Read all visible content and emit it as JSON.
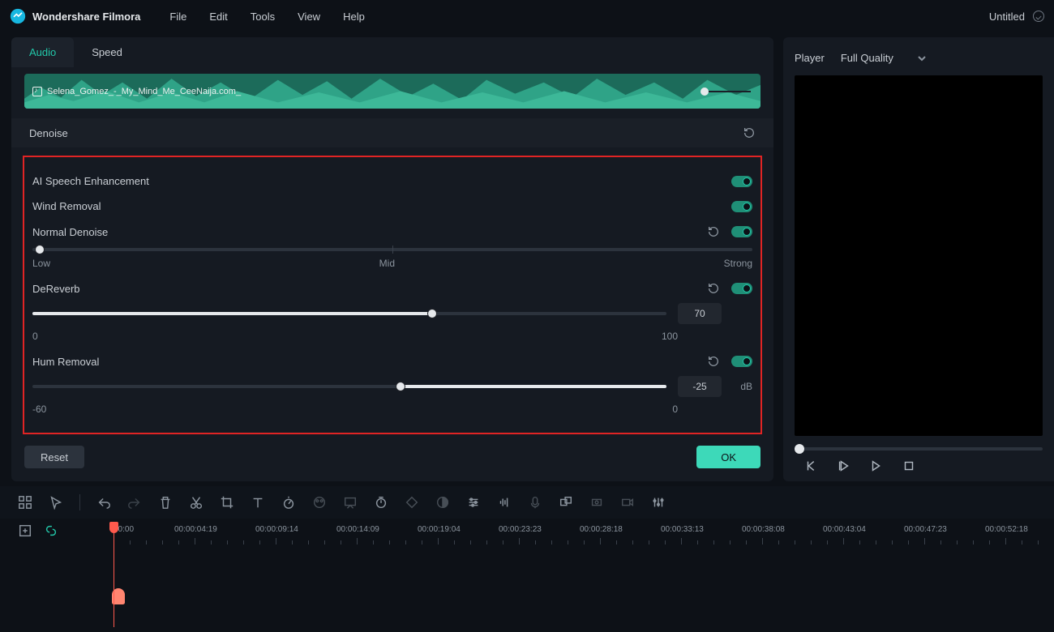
{
  "app": {
    "title": "Wondershare Filmora"
  },
  "menu": [
    "File",
    "Edit",
    "Tools",
    "View",
    "Help"
  ],
  "document": {
    "title": "Untitled"
  },
  "tabs": {
    "audio": "Audio",
    "speed": "Speed"
  },
  "clip": {
    "filename": "Selena_Gomez_-_My_Mind_Me_CeeNaija.com_"
  },
  "section": {
    "denoise": "Denoise"
  },
  "denoise": {
    "ai_speech": {
      "label": "AI Speech Enhancement",
      "on": true
    },
    "wind": {
      "label": "Wind Removal",
      "on": true
    },
    "normal": {
      "label": "Normal Denoise",
      "on": true,
      "value": 0,
      "low": "Low",
      "mid": "Mid",
      "strong": "Strong"
    },
    "dereverb": {
      "label": "DeReverb",
      "on": true,
      "value": "70",
      "min": "0",
      "max": "100",
      "pct": 63
    },
    "hum": {
      "label": "Hum Removal",
      "on": true,
      "value": "-25",
      "min": "-60",
      "max": "0",
      "unit": "dB",
      "pct": 58
    }
  },
  "footer": {
    "reset": "Reset",
    "ok": "OK"
  },
  "player": {
    "label": "Player",
    "quality": "Full Quality"
  },
  "timeline": {
    "start": "00:00",
    "stamps": [
      "00:00:04:19",
      "00:00:09:14",
      "00:00:14:09",
      "00:00:19:04",
      "00:00:23:23",
      "00:00:28:18",
      "00:00:33:13",
      "00:00:38:08",
      "00:00:43:04",
      "00:00:47:23",
      "00:00:52:18"
    ]
  }
}
